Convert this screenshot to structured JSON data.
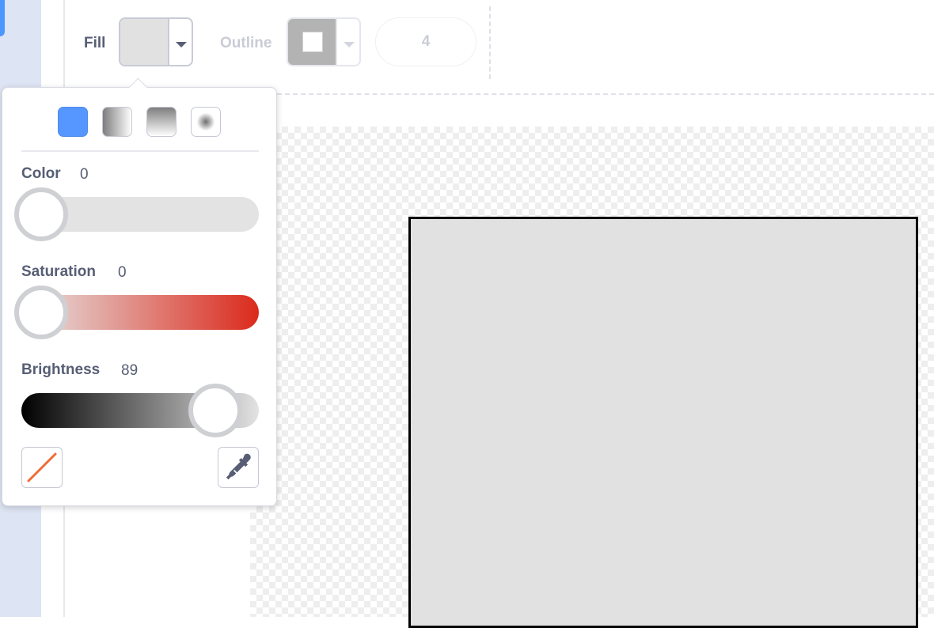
{
  "toolbar": {
    "fill_label": "Fill",
    "outline_label": "Outline",
    "outline_width": "4",
    "fill_color": "#e1e1e1",
    "outline_color": "#b3b3b3"
  },
  "color_picker": {
    "fill_modes": [
      {
        "name": "solid",
        "selected": true
      },
      {
        "name": "horizontal-gradient",
        "selected": false
      },
      {
        "name": "vertical-gradient",
        "selected": false
      },
      {
        "name": "radial-gradient",
        "selected": false
      }
    ],
    "color": {
      "label": "Color",
      "value": "0"
    },
    "saturation": {
      "label": "Saturation",
      "value": "0"
    },
    "brightness": {
      "label": "Brightness",
      "value": "89"
    },
    "no_fill_icon": "slash-icon",
    "eyedropper_icon": "eyedropper-icon"
  },
  "canvas": {
    "shape": "rectangle",
    "shape_fill": "#e1e1e1",
    "shape_outline": "#000000"
  },
  "colors": {
    "accent": "#4c97ff",
    "label_text": "#575e75",
    "saturation_end": "#db2a1c",
    "no_fill_slash": "#ef6b35"
  }
}
